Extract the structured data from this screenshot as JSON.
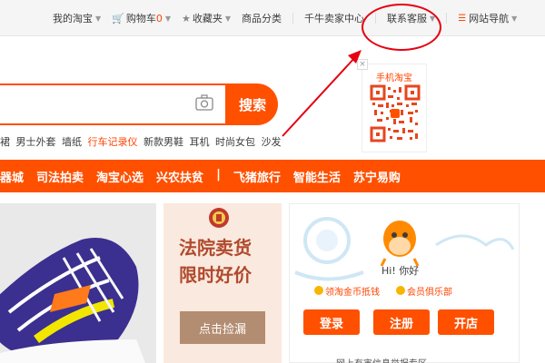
{
  "topnav": {
    "my_taobao": "我的淘宝",
    "cart_label": "购物车",
    "cart_count": "0",
    "favorites": "收藏夹",
    "categories": "商品分类",
    "seller_center": "千牛卖家中心",
    "customer_service": "联系客服",
    "site_nav": "网站导航"
  },
  "search": {
    "button_label": "搜索",
    "hot_words": [
      "裙",
      "男士外套",
      "墙纸"
    ],
    "highlight_word": "行车记录仪",
    "hot_words_tail": [
      "新款男鞋",
      "耳机",
      "时尚女包",
      "沙发"
    ]
  },
  "qr": {
    "title": "手机淘宝",
    "close": "×"
  },
  "category_nav": [
    "器城",
    "司法拍卖",
    "淘宝心选",
    "兴农扶贫",
    "|",
    "飞猪旅行",
    "智能生活",
    "苏宁易购"
  ],
  "court_promo": {
    "line1": "法院卖货",
    "line2": "限时好价",
    "button": "点击捡漏"
  },
  "user_panel": {
    "greeting": "Hi! 你好",
    "badge_coins": "领淘金币抵钱",
    "badge_club": "会员俱乐部",
    "login": "登录",
    "register": "注册",
    "open_shop": "开店",
    "notice": "网上有害信息举报专区"
  },
  "colors": {
    "brand_orange": "#ff5000",
    "annotation_red": "#e60012"
  }
}
